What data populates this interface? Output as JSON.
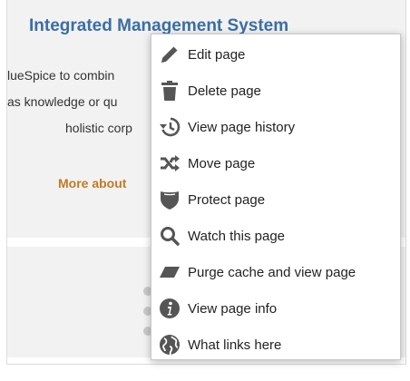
{
  "card": {
    "title": "Integrated Management System",
    "line1": "lueSpice to combin",
    "line2": "as knowledge or qu",
    "line3": "holistic corp",
    "more_link": "More about"
  },
  "menu": {
    "items": [
      {
        "label": "Edit page",
        "icon": "pencil-icon"
      },
      {
        "label": "Delete page",
        "icon": "trash-icon"
      },
      {
        "label": "View page history",
        "icon": "history-icon"
      },
      {
        "label": "Move page",
        "icon": "move-icon"
      },
      {
        "label": "Protect page",
        "icon": "shield-icon"
      },
      {
        "label": "Watch this page",
        "icon": "search-icon"
      },
      {
        "label": "Purge cache and view page",
        "icon": "eraser-icon"
      },
      {
        "label": "View page info",
        "icon": "info-icon"
      },
      {
        "label": "What links here",
        "icon": "globe-icon"
      }
    ]
  },
  "colors": {
    "title": "#3a6ea5",
    "link": "#c27a23",
    "icon": "#555555"
  }
}
